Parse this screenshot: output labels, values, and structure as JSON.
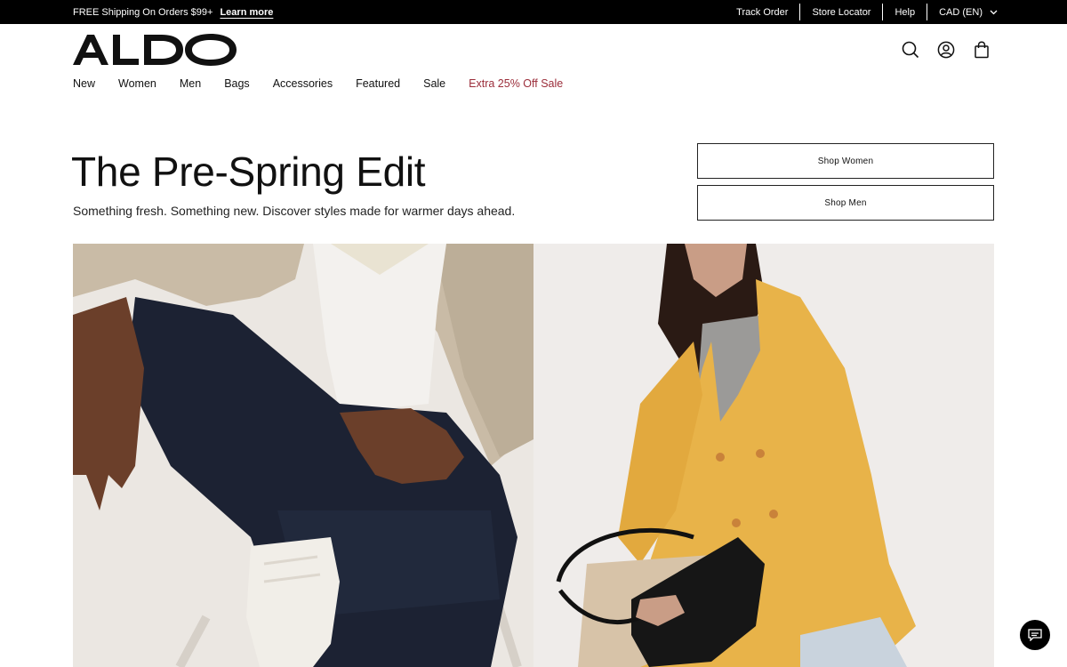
{
  "promo": {
    "text": "FREE Shipping On Orders $99+",
    "link": "Learn more"
  },
  "utility": {
    "track_order": "Track Order",
    "store_locator": "Store Locator",
    "help": "Help",
    "region": "CAD (EN)"
  },
  "logo": "ALDO",
  "nav": {
    "items": [
      {
        "label": "New"
      },
      {
        "label": "Women"
      },
      {
        "label": "Men"
      },
      {
        "label": "Bags"
      },
      {
        "label": "Accessories"
      },
      {
        "label": "Featured"
      },
      {
        "label": "Sale"
      },
      {
        "label": "Extra 25% Off Sale"
      }
    ]
  },
  "hero": {
    "title": "The Pre-Spring Edit",
    "subtitle": "Something fresh. Something new. Discover styles made for warmer days ahead.",
    "cta_women": "Shop Women",
    "cta_men": "Shop Men"
  },
  "icons": {
    "search": "search-icon",
    "account": "user-icon",
    "bag": "shopping-bag-icon",
    "chat": "chat-icon"
  },
  "colors": {
    "promo_bg": "#000000",
    "accent_sale": "#9b2d3a",
    "blazer": "#e8b349"
  }
}
